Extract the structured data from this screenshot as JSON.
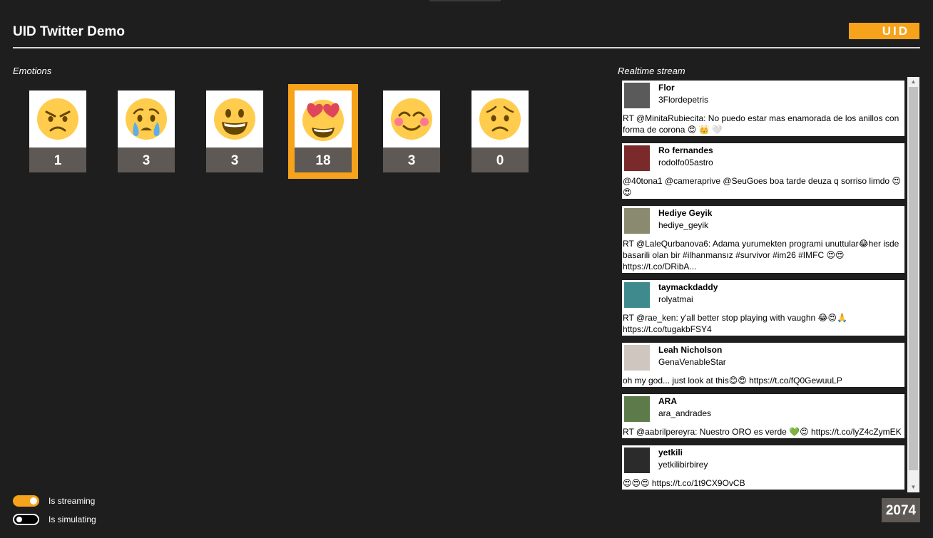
{
  "app": {
    "title": "UID Twitter Demo",
    "logo_text": "UID"
  },
  "emotions": {
    "label": "Emotions",
    "items": [
      {
        "icon": "angry-face-icon",
        "count": "1",
        "selected": false
      },
      {
        "icon": "crying-face-icon",
        "count": "3",
        "selected": false
      },
      {
        "icon": "grinning-face-icon",
        "count": "3",
        "selected": false
      },
      {
        "icon": "heart-eyes-face-icon",
        "count": "18",
        "selected": true
      },
      {
        "icon": "smiling-blush-face-icon",
        "count": "3",
        "selected": false
      },
      {
        "icon": "worried-face-icon",
        "count": "0",
        "selected": false
      }
    ]
  },
  "stream": {
    "label": "Realtime stream",
    "tweets": [
      {
        "name": "Flor",
        "handle": "3Flordepetris",
        "text": "RT @MinitaRubiecita: No puedo estar mas enamorada de los anillos con forma de corona 😍 👑 🤍"
      },
      {
        "name": "Ro fernandes",
        "handle": "rodolfo05astro",
        "text": "@40tona1 @cameraprive @SeuGoes boa tarde deuza q sorriso limdo 😍😍"
      },
      {
        "name": "Hediye Geyik",
        "handle": "hediye_geyik",
        "text": "RT @LaleQurbanova6: Adama yurumekten programi unuttular😂her isde basarili olan bir #ilhanmansız #survivor #im26 #IMFC 😍😍 https://t.co/DRibA..."
      },
      {
        "name": "taymackdaddy",
        "handle": "rolyatmai",
        "text": "RT @rae_ken: y'all better stop playing with vaughn 😂😍🙏 https://t.co/tugakbFSY4"
      },
      {
        "name": "Leah Nicholson",
        "handle": "GenaVenableStar",
        "text": "oh my god... just look at this😊😍 https://t.co/fQ0GewuuLP"
      },
      {
        "name": "ARA",
        "handle": "ara_andrades",
        "text": "RT @aabrilpereyra: Nuestro ORO es verde 💚😍 https://t.co/lyZ4cZymEK"
      },
      {
        "name": "yetkili",
        "handle": "yetkilibirbirey",
        "text": "😍😍😍 https://t.co/1t9CX9OvCB"
      }
    ]
  },
  "controls": {
    "streaming": {
      "label": "Is streaming",
      "on": true
    },
    "simulating": {
      "label": "Is simulating",
      "on": false
    }
  },
  "total_count": "2074",
  "colors": {
    "accent": "#f7a21b",
    "background": "#1e1e1e",
    "count_bg": "#5e5954",
    "emoji_yellow": "#ffcc4d"
  }
}
